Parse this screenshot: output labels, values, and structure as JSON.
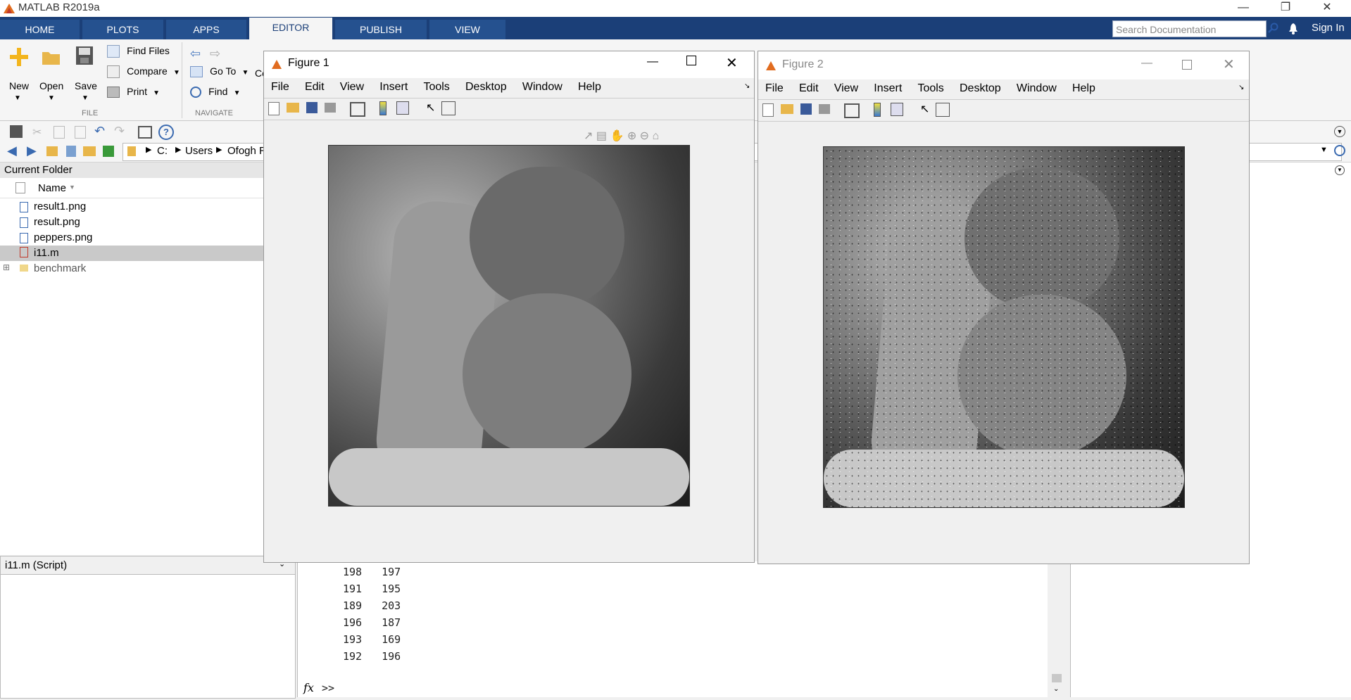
{
  "app": {
    "title": "MATLAB R2019a"
  },
  "ribbon_tabs": [
    "HOME",
    "PLOTS",
    "APPS",
    "EDITOR",
    "PUBLISH",
    "VIEW"
  ],
  "search": {
    "placeholder": "Search Documentation"
  },
  "sign_in": "Sign In",
  "file_section": {
    "new": "New",
    "open": "Open",
    "save": "Save",
    "find_files": "Find Files",
    "compare": "Compare",
    "print": "Print",
    "label": "FILE"
  },
  "navigate_section": {
    "go_to": "Go To",
    "find": "Find",
    "label": "NAVIGATE",
    "partial": "Co"
  },
  "address": {
    "drive": "C:",
    "users": "Users",
    "user": "Ofogh R"
  },
  "current_folder": {
    "title": "Current Folder",
    "column": "Name",
    "files": [
      "result1.png",
      "result.png",
      "peppers.png",
      "i11.m"
    ],
    "folder": "benchmark"
  },
  "details": {
    "title": "i11.m  (Script)"
  },
  "command_window": {
    "rows": [
      [
        "198",
        "197"
      ],
      [
        "191",
        "195"
      ],
      [
        "189",
        "203"
      ],
      [
        "196",
        "187"
      ],
      [
        "193",
        "169"
      ],
      [
        "192",
        "196"
      ]
    ],
    "prompt": ">>",
    "fx": "fx"
  },
  "figure1": {
    "title": "Figure 1",
    "menu": [
      "File",
      "Edit",
      "View",
      "Insert",
      "Tools",
      "Desktop",
      "Window",
      "Help"
    ]
  },
  "figure2": {
    "title": "Figure 2",
    "menu": [
      "File",
      "Edit",
      "View",
      "Insert",
      "Tools",
      "Desktop",
      "Window",
      "Help"
    ]
  },
  "colors": {
    "ribbon_blue": "#1b3f78",
    "tab_blue": "#25518f",
    "selected_row": "#c9c9c9"
  }
}
